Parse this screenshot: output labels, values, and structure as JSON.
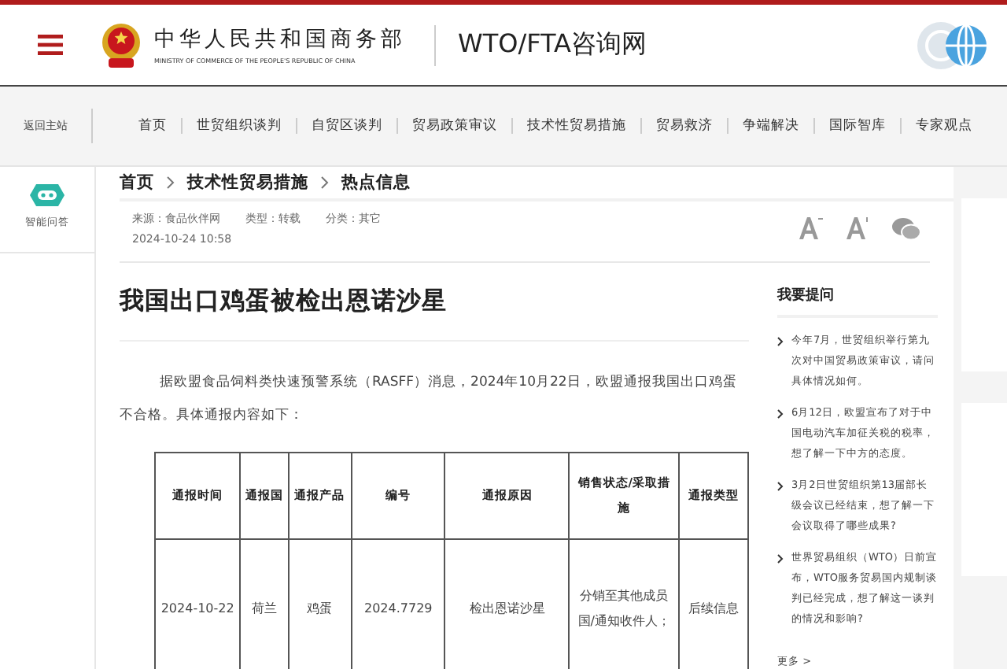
{
  "header": {
    "ministry_name": "中华人民共和国商务部",
    "ministry_name_en": "MINISTRY OF COMMERCE OF THE PEOPLE'S REPUBLIC OF CHINA",
    "site_title": "WTO/FTA咨询网"
  },
  "nav": {
    "back_link": "返回主站",
    "items": [
      {
        "label": "首页",
        "selected": false
      },
      {
        "label": "世贸组织谈判",
        "selected": false
      },
      {
        "label": "自贸区谈判",
        "selected": false
      },
      {
        "label": "贸易政策审议",
        "selected": false
      },
      {
        "label": "技术性贸易措施",
        "selected": false
      },
      {
        "label": "贸易救济",
        "selected": false
      },
      {
        "label": "争端解决",
        "selected": false
      },
      {
        "label": "国际智库",
        "selected": false
      },
      {
        "label": "专家观点",
        "selected": false
      }
    ]
  },
  "side_tool": {
    "label": "智能问答"
  },
  "breadcrumb": [
    "首页",
    "技术性贸易措施",
    "热点信息"
  ],
  "meta": {
    "source": "来源：食品伙伴网",
    "type": "类型：转载",
    "category": "分类：其它",
    "datetime": "2024-10-24 10:58"
  },
  "article": {
    "title": "我国出口鸡蛋被检出恩诺沙星",
    "paragraph": "据欧盟食品饲料类快速预警系统（RASFF）消息，2024年10月22日，欧盟通报我国出口鸡蛋不合格。具体通报内容如下："
  },
  "table": {
    "columns": [
      "通报时间",
      "通报国",
      "通报产品",
      "编号",
      "通报原因",
      "销售状态/采取措施",
      "通报类型"
    ],
    "rows": [
      [
        "2024-10-22",
        "荷兰",
        "鸡蛋",
        "2024.7729",
        "检出恩诺沙星",
        "分销至其他成员国/通知收件人；",
        "后续信息"
      ]
    ]
  },
  "questions": {
    "title": "我要提问",
    "items": [
      "今年7月，世贸组织举行第九次对中国贸易政策审议，请问具体情况如何。",
      "6月12日，欧盟宣布了对于中国电动汽车加征关税的税率，想了解一下中方的态度。",
      "3月2日世贸组织第13届部长级会议已经结束，想了解一下会议取得了哪些成果?",
      "世界贸易组织（WTO）日前宣布，WTO服务贸易国内规制谈判已经完成，想了解这一谈判的情况和影响?"
    ],
    "more": "更多 >"
  }
}
